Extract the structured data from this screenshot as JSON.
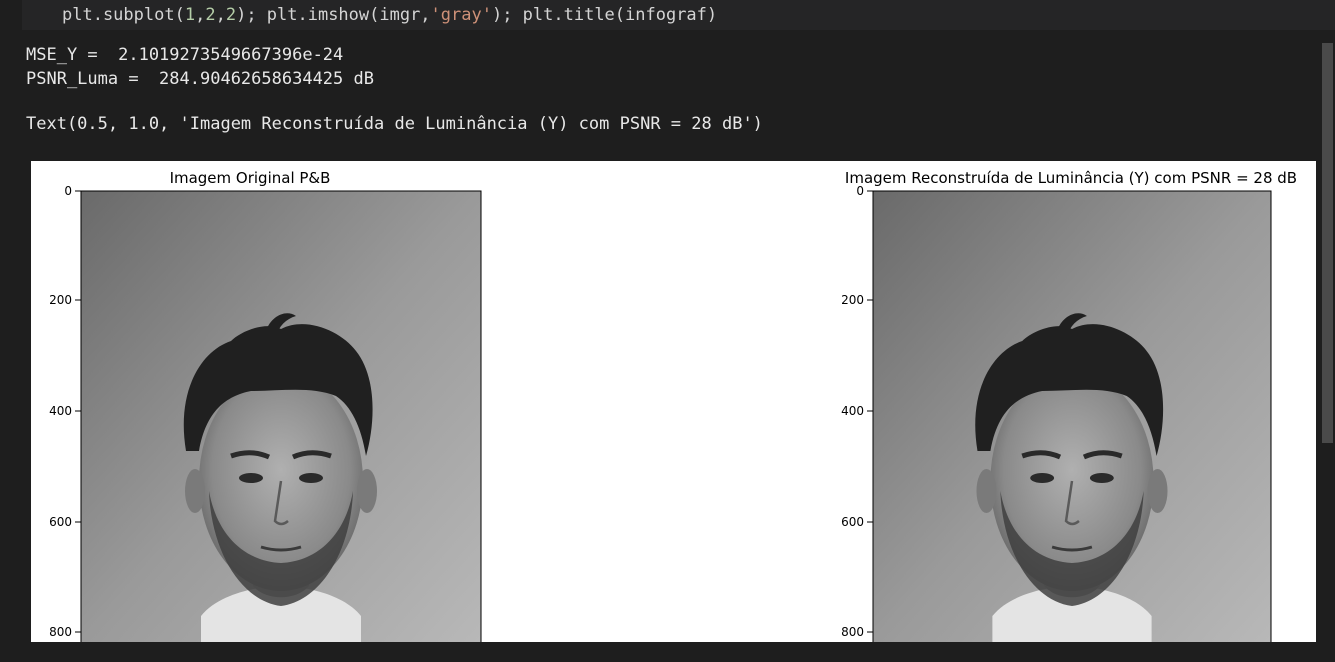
{
  "code_cell": {
    "line_prefix": "plt.subplot(",
    "line_args": [
      "1",
      ",",
      "2",
      ",",
      "2"
    ],
    "line_mid": "); plt.imshow(imgr,",
    "line_string": "'gray'",
    "line_suffix": "); plt.title(infograf)"
  },
  "output": {
    "mse_line": "MSE_Y =  2.1019273549667396e-24",
    "psnr_line": "PSNR_Luma =  284.90462658634425 dB",
    "text_repr": "Text(0.5, 1.0, 'Imagem Reconstruída de Luminância (Y) com PSNR = 28 dB')"
  },
  "figure": {
    "subplots": [
      {
        "title": "Imagem Original P&B",
        "yticks": [
          "0",
          "200",
          "400",
          "600",
          "800"
        ],
        "image": "grayscale-portrait"
      },
      {
        "title": "Imagem Reconstruída de Luminância (Y) com PSNR = 28 dB",
        "yticks": [
          "0",
          "200",
          "400",
          "600",
          "800"
        ],
        "image": "grayscale-portrait"
      }
    ]
  },
  "colors": {
    "background": "#1e1e1e",
    "code_cell": "#252526",
    "number": "#b5cea8",
    "string": "#ce9178"
  }
}
